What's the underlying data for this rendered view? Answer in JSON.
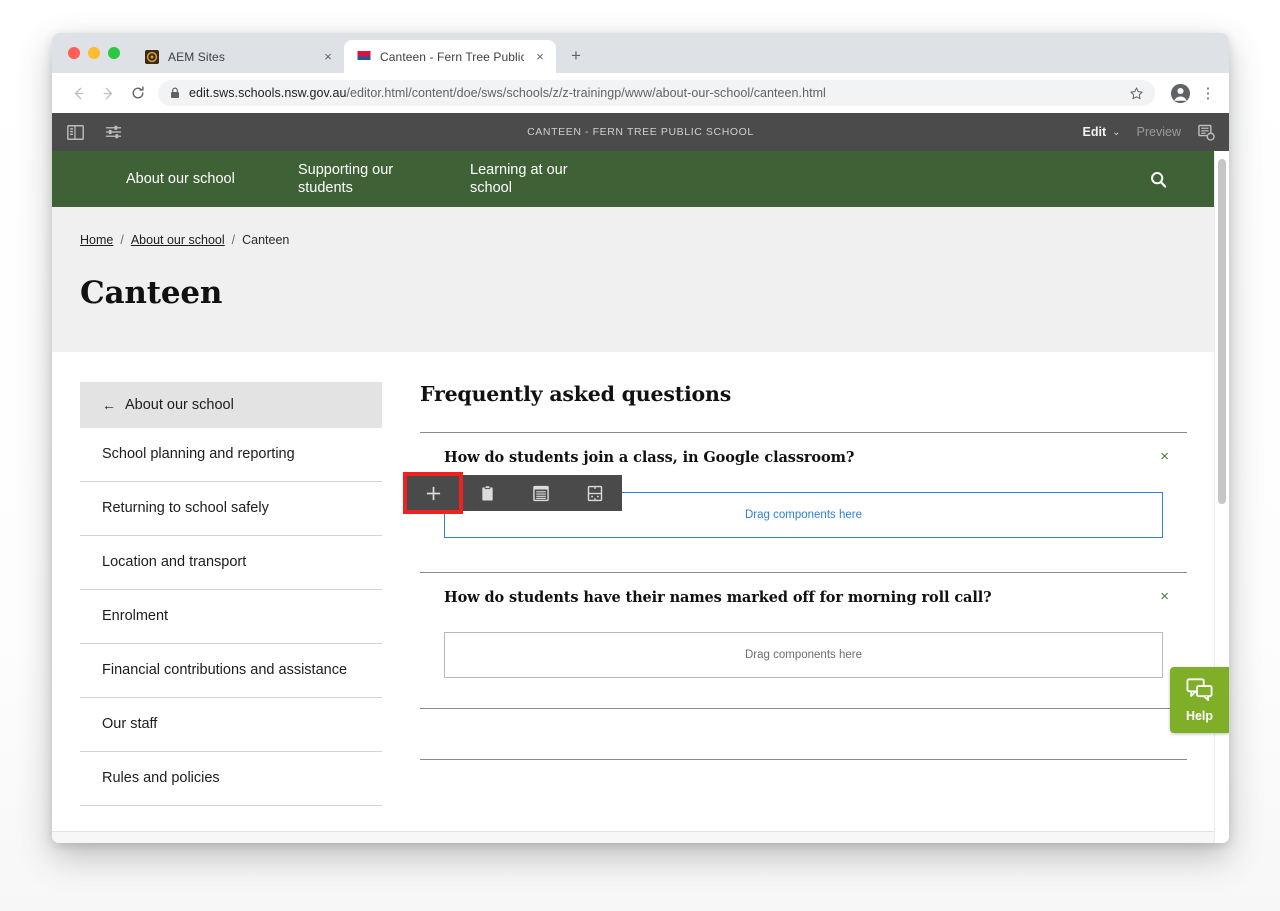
{
  "browser": {
    "tabs": [
      {
        "title": "AEM Sites",
        "favicon": "aem-icon",
        "active": false
      },
      {
        "title": "Canteen - Fern Tree Public Sch",
        "favicon": "nsw-waratah-icon",
        "active": true
      }
    ],
    "new_tab_label": "+",
    "close_label": "×",
    "back_label": "←",
    "forward_label": "→",
    "reload_label": "⟳",
    "url_secure_text": "edit.sws.schools.nsw.gov.au",
    "url_path_text": "/editor.html/content/doe/sws/schools/z/z-trainingp/www/about-our-school/canteen.html",
    "kebab_label": "⋮"
  },
  "aem_toolbar": {
    "page_title": "CANTEEN - FERN TREE PUBLIC SCHOOL",
    "edit_label": "Edit",
    "edit_caret": "⌄",
    "preview_label": "Preview",
    "left_icons": [
      "side-panel-toggle-icon",
      "page-information-icon"
    ],
    "right_icon": "page-properties-icon"
  },
  "site_nav": {
    "items": [
      "About our school",
      "Supporting our\nstudents",
      "Learning at our\nschool"
    ],
    "items_flat": [
      "About our school",
      "Supporting our students",
      "Learning at our school"
    ],
    "search_icon": "search-icon",
    "bg_color": "#3f6136"
  },
  "breadcrumb": {
    "home": "Home",
    "sep": "/",
    "parent": "About our school",
    "current": "Canteen"
  },
  "page": {
    "title": "Canteen"
  },
  "sidebar": {
    "header": "About our school",
    "back_arrow": "←",
    "items": [
      "School planning and reporting",
      "Returning to school safely",
      "Location and transport",
      "Enrolment",
      "Financial contributions and assistance",
      "Our staff",
      "Rules and policies"
    ]
  },
  "main": {
    "section_title": "Frequently asked questions",
    "faqs": [
      {
        "question": "How do students join a class, in Google classroom?",
        "close_label": "×",
        "dropzone_text": "Drag components here",
        "dropzone_active": true
      },
      {
        "question": "How do students have their names marked off for morning roll call?",
        "close_label": "×",
        "dropzone_text": "Drag components here",
        "dropzone_active": false
      }
    ]
  },
  "component_toolbar": {
    "buttons": [
      {
        "name": "insert-component-button",
        "icon": "plus-icon",
        "label": "+",
        "highlighted": true
      },
      {
        "name": "paste-button",
        "icon": "clipboard-icon",
        "label": "",
        "highlighted": false
      },
      {
        "name": "layout-container-button",
        "icon": "layout-list-icon",
        "label": "",
        "highlighted": false
      },
      {
        "name": "group-button",
        "icon": "component-group-icon",
        "label": "",
        "highlighted": false
      }
    ],
    "highlight_color": "#ef2121",
    "bg_color": "#4a4a4a"
  },
  "help_widget": {
    "label": "Help",
    "icon": "chat-bubbles-icon",
    "color": "#7fae28"
  }
}
